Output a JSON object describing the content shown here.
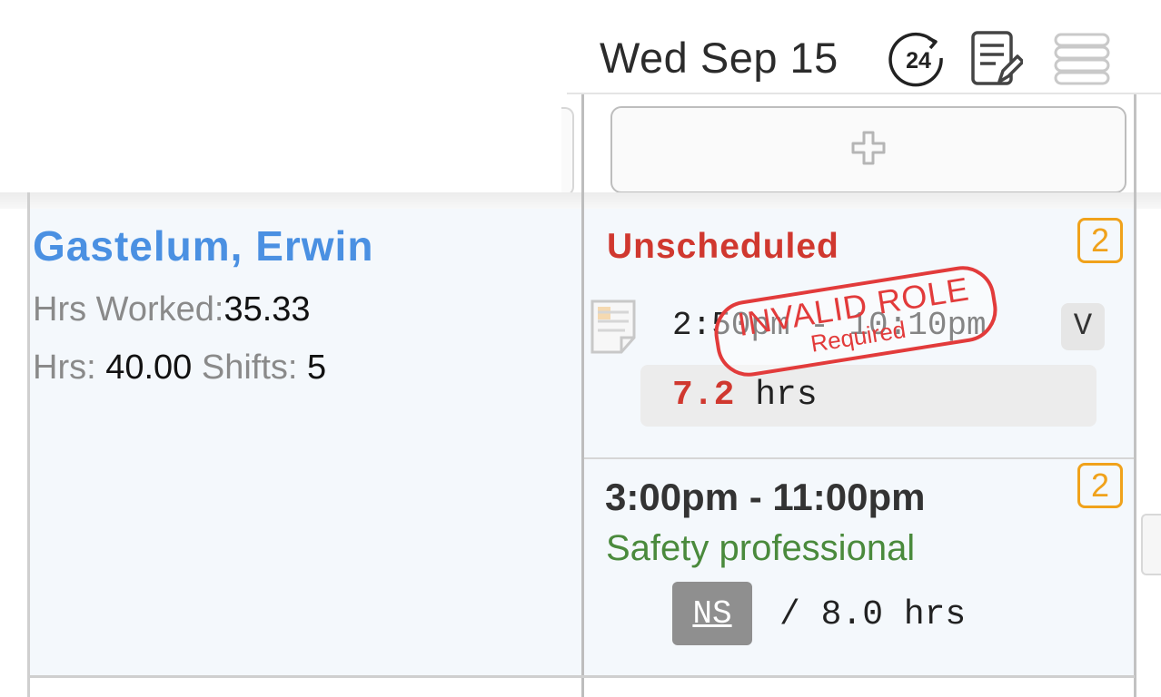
{
  "header": {
    "date": "Wed Sep 15",
    "icons": [
      "24-hour-icon",
      "notes-icon",
      "stack-icon"
    ]
  },
  "toolbar": {
    "add_icon": "plus-icon"
  },
  "employee": {
    "name": "Gastelum, Erwin",
    "hrs_worked_label": "Hrs Worked:",
    "hrs_worked_value": "35.33",
    "hrs_label": "Hrs:",
    "hrs_value": "40.00",
    "shifts_label": "Shifts:",
    "shifts_value": "5"
  },
  "day": {
    "entries": [
      {
        "title": "Unscheduled",
        "badge": "2",
        "time": "2:50pm - 10:10pm",
        "v_label": "V",
        "hours_value": "7.2",
        "hours_unit": "hrs",
        "stamp_main": "INVALID ROLE",
        "stamp_sub": "Required"
      },
      {
        "time": "3:00pm - 11:00pm",
        "badge": "2",
        "role": "Safety professional",
        "ns_label": "NS",
        "hours_text": "/ 8.0 hrs"
      }
    ]
  },
  "colors": {
    "accent_blue": "#4a90e2",
    "alert_red": "#d0382f",
    "badge_orange": "#f0a21b",
    "role_green": "#4a8a3c"
  }
}
